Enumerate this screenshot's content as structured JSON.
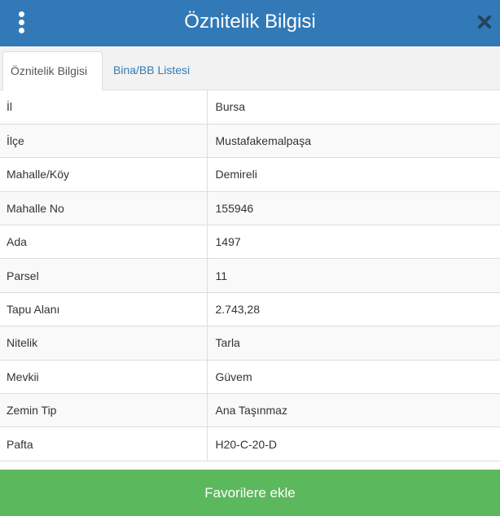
{
  "header": {
    "title": "Öznitelik Bilgisi",
    "menu_icon": "kebab-menu-icon",
    "close_icon": "close-icon",
    "color": "#3279b7"
  },
  "tabs": [
    {
      "label": "Öznitelik Bilgisi",
      "active": true
    },
    {
      "label": "Bina/BB Listesi",
      "active": false
    }
  ],
  "attributes": [
    {
      "key": "İl",
      "value": "Bursa"
    },
    {
      "key": "İlçe",
      "value": "Mustafakemalpaşa"
    },
    {
      "key": "Mahalle/Köy",
      "value": "Demireli"
    },
    {
      "key": "Mahalle No",
      "value": "155946"
    },
    {
      "key": "Ada",
      "value": "1497"
    },
    {
      "key": "Parsel",
      "value": "11"
    },
    {
      "key": "Tapu Alanı",
      "value": "2.743,28"
    },
    {
      "key": "Nitelik",
      "value": "Tarla"
    },
    {
      "key": "Mevkii",
      "value": "Güvem"
    },
    {
      "key": "Zemin Tip",
      "value": "Ana Taşınmaz"
    },
    {
      "key": "Pafta",
      "value": "H20-C-20-D"
    }
  ],
  "footer": {
    "favorite_label": "Favorilere ekle",
    "color": "#5cb85c"
  }
}
